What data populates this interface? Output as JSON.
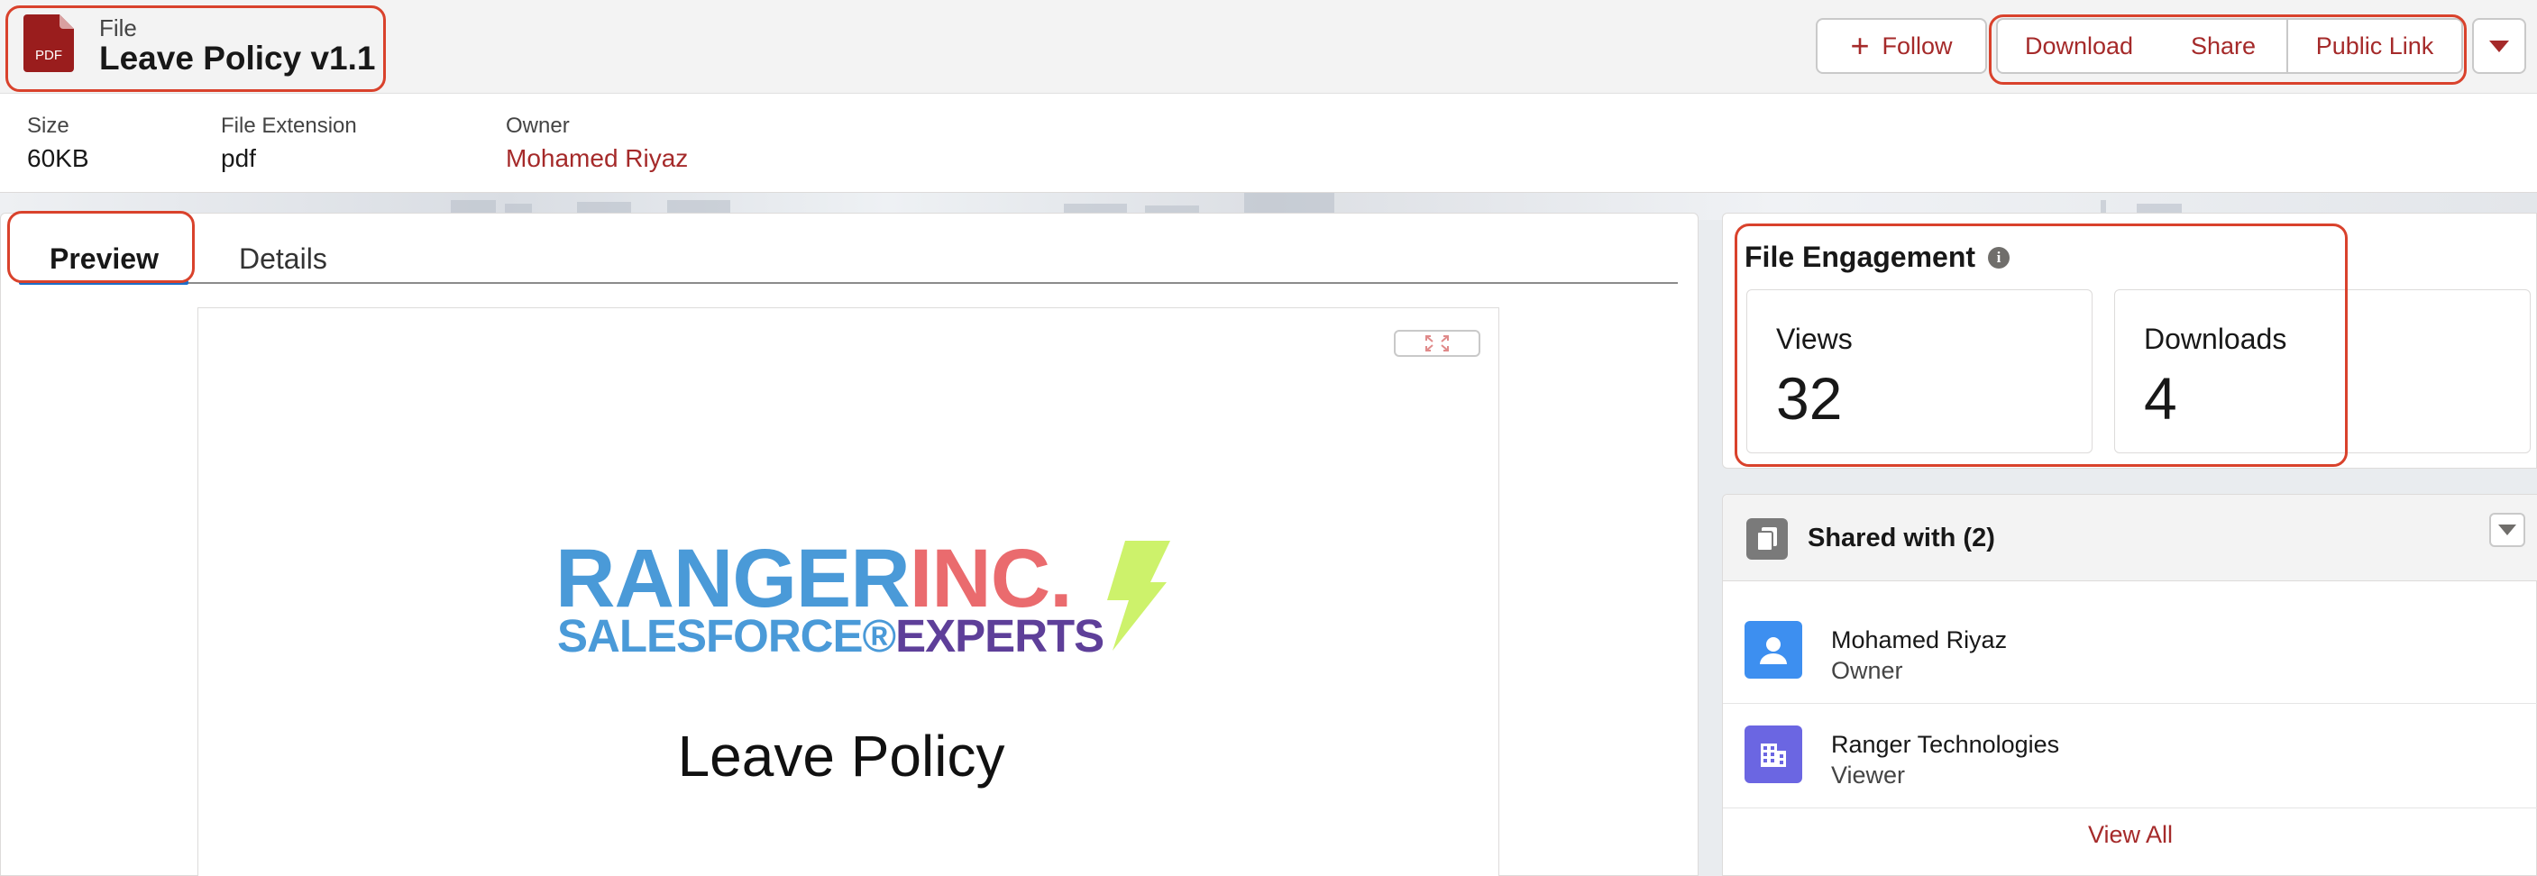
{
  "header": {
    "file_type_label": "File",
    "file_icon_text": "PDF",
    "title": "Leave Policy v1.1",
    "follow_label": "Follow",
    "actions": [
      "Download",
      "Share",
      "Public Link"
    ]
  },
  "meta": [
    {
      "label": "Size",
      "value": "60KB"
    },
    {
      "label": "File Extension",
      "value": "pdf"
    },
    {
      "label": "Owner",
      "value": "Mohamed Riyaz"
    }
  ],
  "tabs": [
    "Preview",
    "Details"
  ],
  "active_tab": "Preview",
  "preview": {
    "logo_main_1": "RANGER",
    "logo_main_2": "INC.",
    "logo_sub_1": "SALESFORCE®",
    "logo_sub_2": "EXPERTS",
    "document_title": "Leave Policy"
  },
  "engagement": {
    "title": "File Engagement",
    "views_label": "Views",
    "views_value": "32",
    "downloads_label": "Downloads",
    "downloads_value": "4"
  },
  "shared": {
    "title": "Shared with (2)",
    "people": [
      {
        "name": "Mohamed Riyaz",
        "role": "Owner",
        "icon": "user-icon"
      },
      {
        "name": "Ranger Technologies",
        "role": "Viewer",
        "icon": "building-icon"
      }
    ],
    "view_all": "View All"
  },
  "colors": {
    "brand_link": "#a52a2a",
    "highlight": "#d9422c",
    "tab_active": "#1b6fc9",
    "pdf_icon": "#9a1d1d",
    "logo_blue": "#4a9ad8",
    "logo_red": "#ea6b6e",
    "logo_purple": "#5e3f99",
    "bolt": "#cdf26b"
  }
}
